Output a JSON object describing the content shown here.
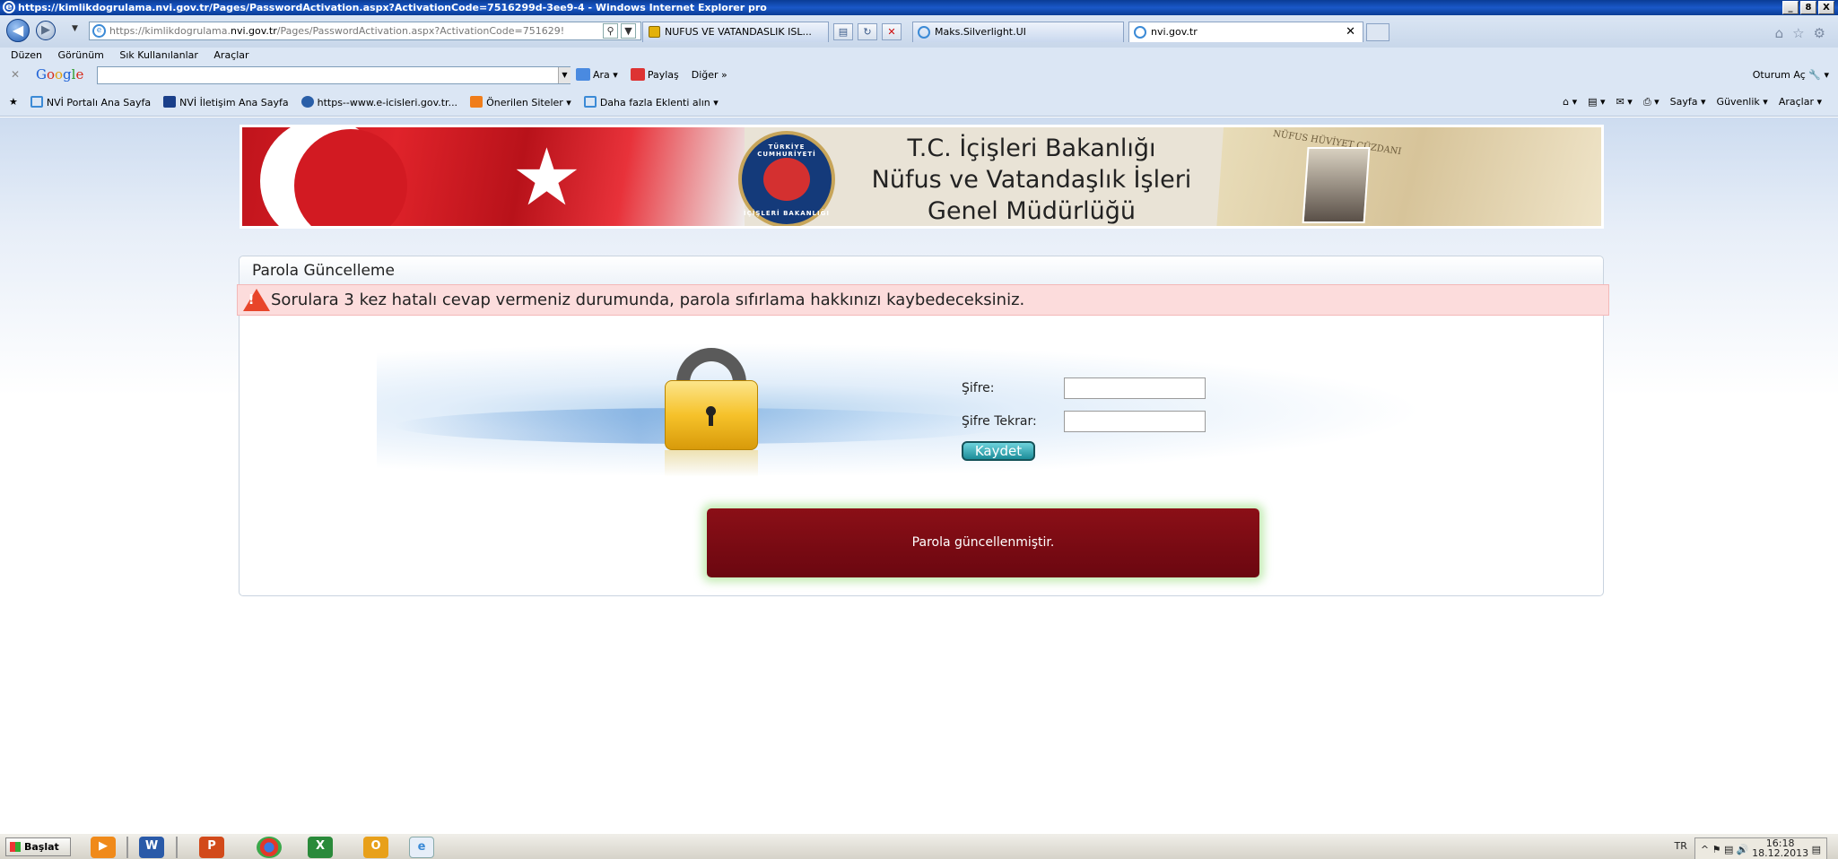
{
  "window": {
    "title": "https://kimlikdogrulama.nvi.gov.tr/Pages/PasswordActivation.aspx?ActivationCode=7516299d-3ee9-4 - Windows Internet Explorer pro",
    "controls": [
      "_",
      "8",
      "X"
    ]
  },
  "navbar": {
    "address_prefix": "https://kimlikdogrulama.",
    "address_domain": "nvi.gov.tr",
    "address_path": "/Pages/PasswordActivation.aspx?ActivationCode=751629!",
    "tabs": [
      {
        "label": "NUFUS VE VATANDASLIK ISL...",
        "state": "open"
      },
      {
        "label": "Maks.Silverlight.UI",
        "state": "open"
      },
      {
        "label": "nvi.gov.tr",
        "state": "active"
      }
    ]
  },
  "menu": [
    "Düzen",
    "Görünüm",
    "Sık Kullanılanlar",
    "Araçlar"
  ],
  "google_bar": {
    "logo": "Google",
    "search_value": "",
    "items": [
      "Ara",
      "Paylaş",
      "Diğer »"
    ],
    "signin": "Oturum Aç"
  },
  "favorites": {
    "items": [
      "NVİ Portalı Ana Sayfa",
      "NVİ İletişim Ana Sayfa",
      "https--www.e-icisleri.gov.tr...",
      "Önerilen Siteler",
      "Daha fazla Eklenti alın"
    ],
    "right": [
      "Sayfa",
      "Güvenlik",
      "Araçlar"
    ]
  },
  "banner": {
    "line1": "T.C. İçişleri Bakanlığı",
    "line2": "Nüfus ve Vatandaşlık İşleri",
    "line3": "Genel Müdürlüğü",
    "seal_top": "TÜRKİYE CUMHURİYETİ",
    "seal_bottom": "İÇİŞLERİ BAKANLIĞI",
    "doc_text": "NÜFUS HÜVİYET CÜZDANI"
  },
  "panel": {
    "title": "Parola Güncelleme",
    "warning": "Sorulara 3 kez hatalı cevap vermeniz durumunda, parola sıfırlama hakkınızı kaybedeceksiniz.",
    "password_label": "Şifre:",
    "password_repeat_label": "Şifre Tekrar:",
    "password_value": "",
    "password_repeat_value": "",
    "save_button": "Kaydet",
    "success_message": "Parola güncellenmiştir."
  },
  "taskbar": {
    "start": "Başlat",
    "lang": "TR",
    "time": "16:18",
    "date": "18.12.2013"
  }
}
